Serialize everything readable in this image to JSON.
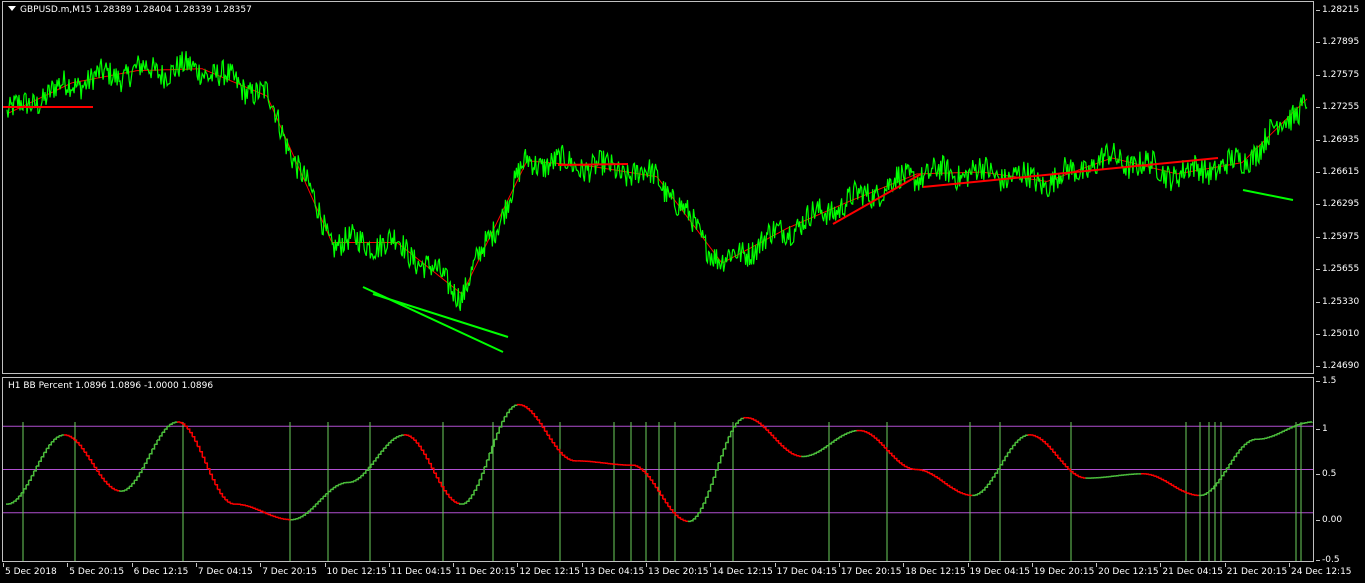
{
  "main_chart": {
    "title": "GBPUSD.m,M15  1.28389 1.28404 1.28339 1.28357",
    "price_ticks": [
      "1.28215",
      "1.27895",
      "1.27575",
      "1.27255",
      "1.26935",
      "1.26615",
      "1.26295",
      "1.25975",
      "1.25655",
      "1.25330",
      "1.25010",
      "1.24690"
    ],
    "colors": {
      "price": "#00ff00",
      "ma": "#ff0000",
      "background": "#000000"
    }
  },
  "indicator": {
    "title": "H1   BB Percent 1.0896 1.0896 -1.0000 1.0896",
    "ticks": [
      "1.5",
      "1",
      "0.5",
      "0.00",
      "-0.5"
    ],
    "level_color": "#b04fd0",
    "up_color": "#4cbf3c",
    "down_color": "#ff0000"
  },
  "time_labels": [
    "5 Dec 2018",
    "5 Dec 20:15",
    "6 Dec 12:15",
    "7 Dec 04:15",
    "7 Dec 20:15",
    "10 Dec 12:15",
    "11 Dec 04:15",
    "11 Dec 20:15",
    "12 Dec 12:15",
    "13 Dec 04:15",
    "13 Dec 20:15",
    "14 Dec 12:15",
    "17 Dec 04:15",
    "17 Dec 20:15",
    "18 Dec 12:15",
    "19 Dec 04:15",
    "19 Dec 20:15",
    "20 Dec 12:15",
    "21 Dec 04:15",
    "21 Dec 20:15",
    "24 Dec 12:15"
  ],
  "chart_data": [
    {
      "type": "line",
      "title": "GBPUSD.m,M15  1.28389 1.28404 1.28339 1.28357",
      "x": [
        "5 Dec 2018",
        "5 Dec 20:15",
        "6 Dec 12:15",
        "7 Dec 04:15",
        "7 Dec 20:15",
        "10 Dec 12:15",
        "11 Dec 04:15",
        "11 Dec 20:15",
        "12 Dec 12:15",
        "13 Dec 04:15",
        "13 Dec 20:15",
        "14 Dec 12:15",
        "17 Dec 04:15",
        "17 Dec 20:15",
        "18 Dec 12:15",
        "19 Dec 04:15",
        "19 Dec 20:15",
        "20 Dec 12:15",
        "21 Dec 04:15",
        "21 Dec 20:15",
        "24 Dec 12:15"
      ],
      "series": [
        {
          "values": [
            1.2712,
            1.2745,
            1.2758,
            1.276,
            1.2731,
            1.2575,
            1.2575,
            1.252,
            1.2662,
            1.2656,
            1.2645,
            1.2553,
            1.259,
            1.262,
            1.2648,
            1.265,
            1.264,
            1.2665,
            1.2648,
            1.266,
            1.2728
          ]
        }
      ],
      "ylim": [
        1.2469,
        1.28215
      ]
    },
    {
      "type": "line",
      "title": "H1   BB Percent 1.0896 1.0896 -1.0000 1.0896",
      "x": [
        "5 Dec 2018",
        "5 Dec 20:15",
        "6 Dec 12:15",
        "7 Dec 04:15",
        "7 Dec 20:15",
        "10 Dec 12:15",
        "11 Dec 04:15",
        "11 Dec 20:15",
        "12 Dec 12:15",
        "13 Dec 04:15",
        "13 Dec 20:15",
        "14 Dec 12:15",
        "17 Dec 04:15",
        "17 Dec 20:15",
        "18 Dec 12:15",
        "19 Dec 04:15",
        "19 Dec 20:15",
        "20 Dec 12:15",
        "21 Dec 04:15",
        "21 Dec 20:15",
        "24 Dec 12:15"
      ],
      "series": [
        {
          "values": [
            0.1,
            0.9,
            0.25,
            1.05,
            0.1,
            -0.08,
            0.35,
            0.9,
            0.1,
            1.25,
            0.6,
            0.55,
            -0.1,
            1.1,
            0.65,
            0.95,
            0.5,
            0.2,
            0.9,
            0.4,
            0.45,
            0.2,
            0.85,
            1.05
          ]
        }
      ],
      "levels": [
        1,
        0.5,
        0
      ],
      "ylim": [
        -0.5,
        1.5
      ]
    }
  ]
}
